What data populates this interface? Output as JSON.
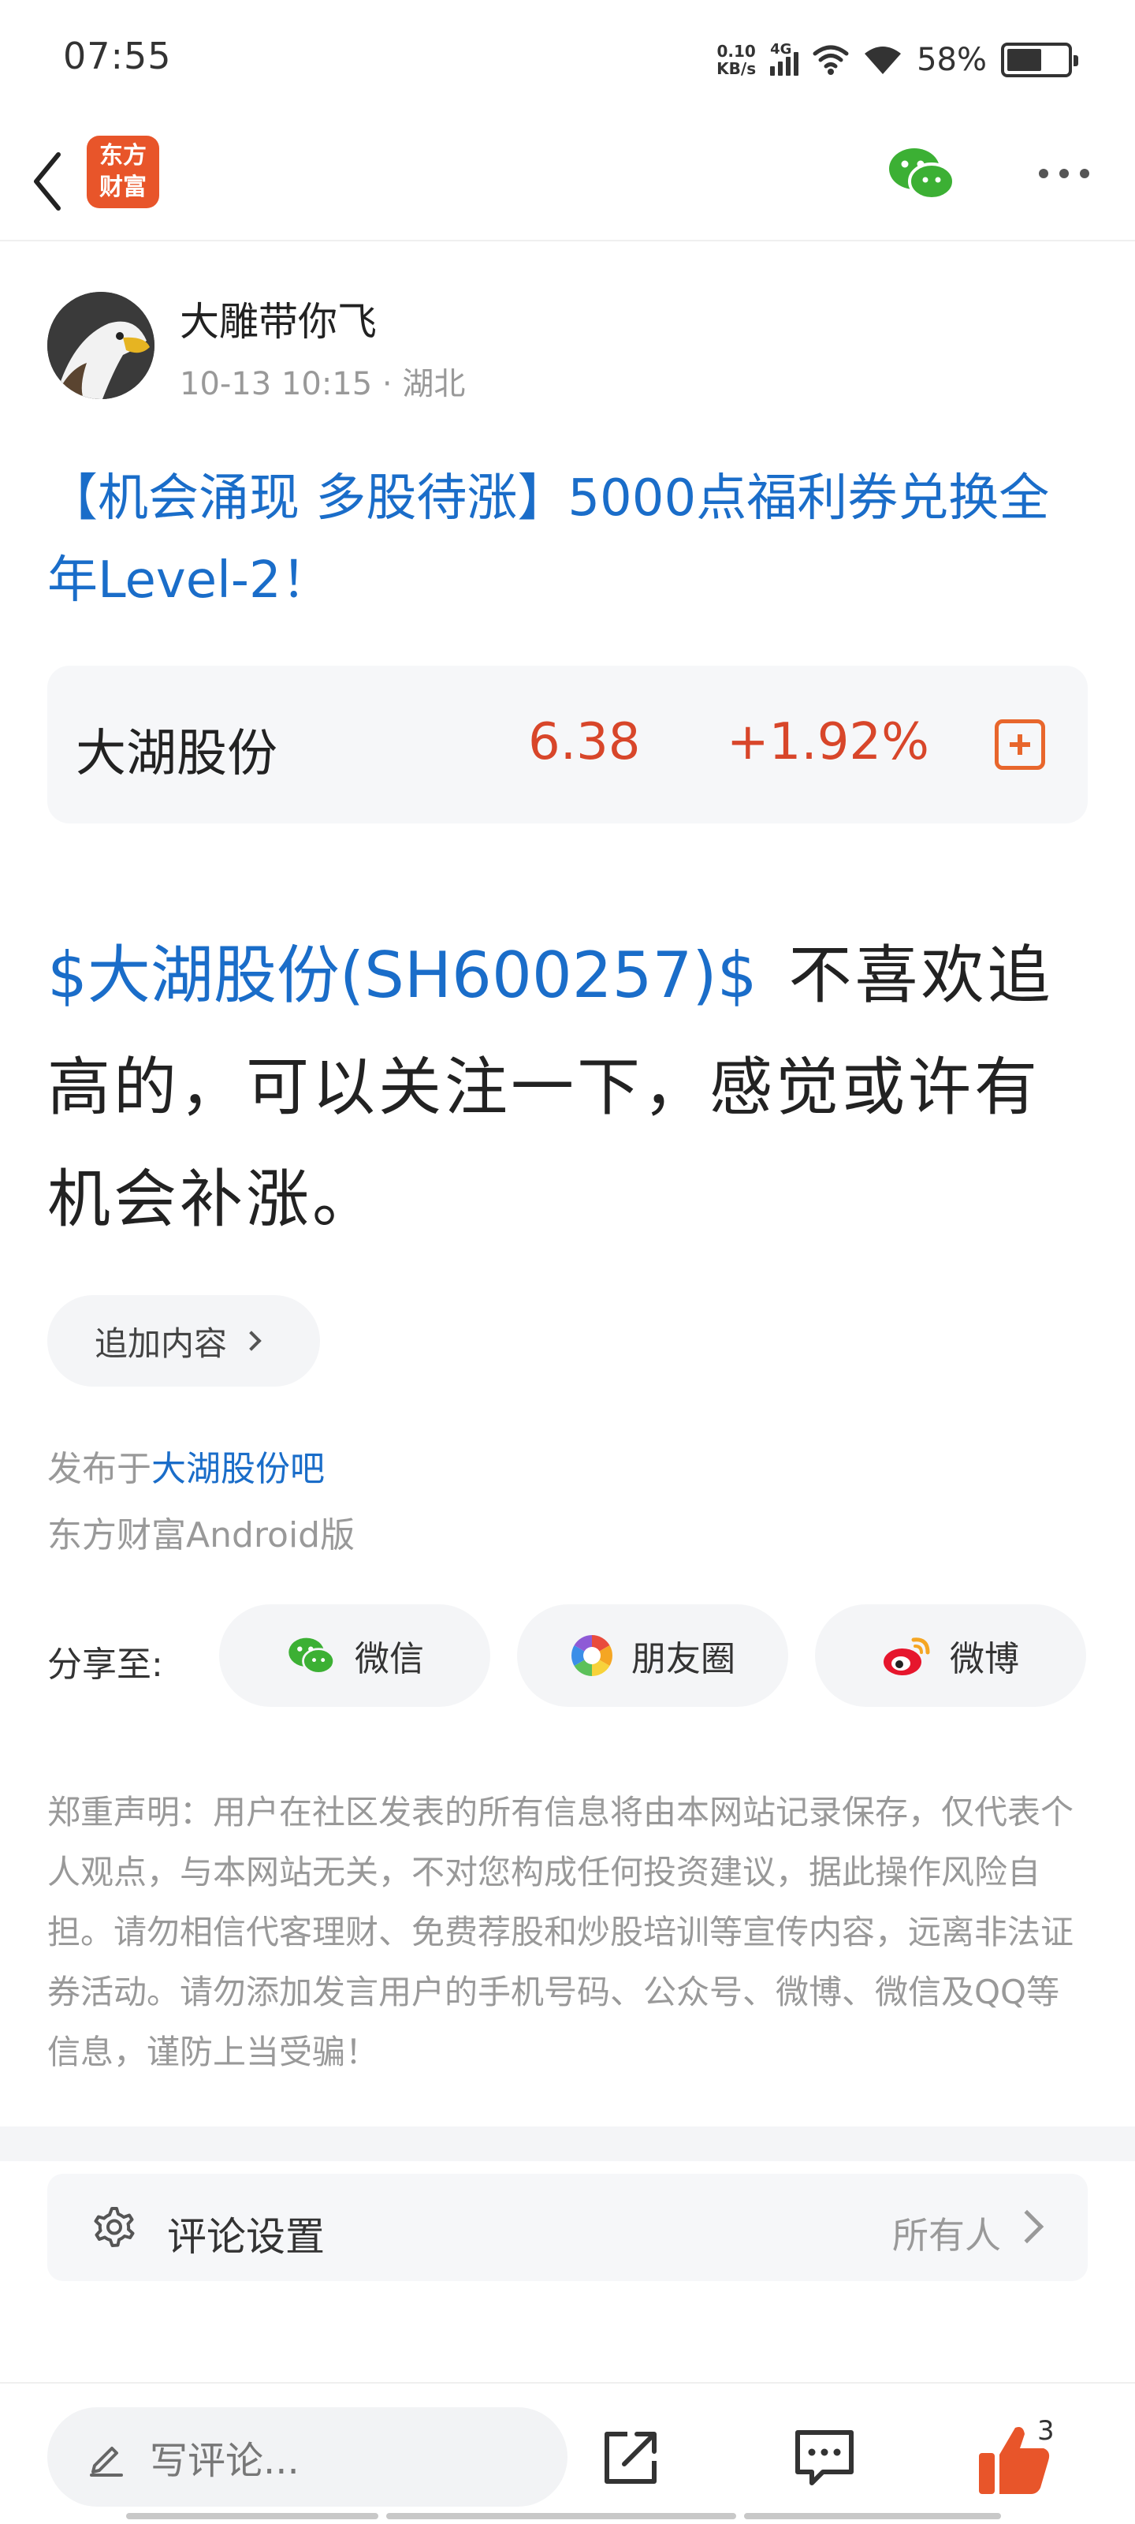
{
  "status_bar": {
    "time": "07:55",
    "net_speed_value": "0.10",
    "net_speed_unit": "KB/s",
    "network": "4G",
    "battery": "58%"
  },
  "nav": {
    "logo_line1": "东方",
    "logo_line2": "财富"
  },
  "author": {
    "name": "大雕带你飞",
    "meta": "10-13 10:15  · 湖北"
  },
  "post": {
    "title": "【机会涌现 多股待涨】5000点福利券兑换全年Level-2！",
    "body_stock_link": "$大湖股份(SH600257)$",
    "body_text": "不喜欢追高的，可以关注一下，感觉或许有机会补涨。",
    "append_label": "追加内容",
    "published_prefix": "发布于",
    "published_bar": "大湖股份吧",
    "client": "东方财富Android版"
  },
  "stock": {
    "name": "大湖股份",
    "price": "6.38",
    "change": "+1.92%"
  },
  "share": {
    "label": "分享至:",
    "wechat": "微信",
    "moments": "朋友圈",
    "weibo": "微博"
  },
  "disclaimer": "郑重声明：用户在社区发表的所有信息将由本网站记录保存，仅代表个人观点，与本网站无关，不对您构成任何投资建议，据此操作风险自担。请勿相信代客理财、免费荐股和炒股培训等宣传内容，远离非法证券活动。请勿添加发言用户的手机号码、公众号、微博、微信及QQ等信息，谨防上当受骗！",
  "comment_settings": {
    "label": "评论设置",
    "value": "所有人"
  },
  "bottom_bar": {
    "comment_placeholder": "写评论...",
    "like_count": "3"
  },
  "colors": {
    "link_blue": "#1a6dc9",
    "stock_red": "#d8462a",
    "accent_orange": "#e8662c"
  }
}
